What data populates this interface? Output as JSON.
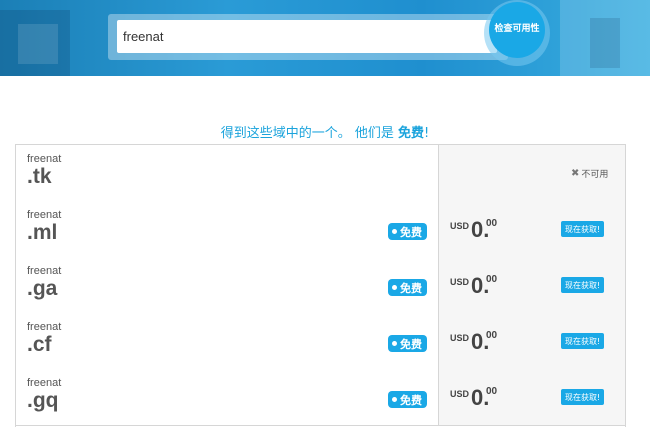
{
  "search": {
    "value": "freenat",
    "button_label": "检查可用性"
  },
  "headline": {
    "prefix": "得到这些域中的一个。 他们是 ",
    "bold": "免费",
    "suffix": "!"
  },
  "results": [
    {
      "name": "freenat",
      "tld": ".tk",
      "available": false,
      "status_label": "不可用"
    },
    {
      "name": "freenat",
      "tld": ".ml",
      "available": true,
      "badge": "免费",
      "currency": "USD",
      "price_int": "0.",
      "price_dec": "00",
      "button": "现在获取!"
    },
    {
      "name": "freenat",
      "tld": ".ga",
      "available": true,
      "badge": "免费",
      "currency": "USD",
      "price_int": "0.",
      "price_dec": "00",
      "button": "现在获取!"
    },
    {
      "name": "freenat",
      "tld": ".cf",
      "available": true,
      "badge": "免费",
      "currency": "USD",
      "price_int": "0.",
      "price_dec": "00",
      "button": "现在获取!"
    },
    {
      "name": "freenat",
      "tld": ".gq",
      "available": true,
      "badge": "免费",
      "currency": "USD",
      "price_int": "0.",
      "price_dec": "00",
      "button": "现在获取!"
    }
  ],
  "colors": {
    "accent": "#1aa8e6",
    "headline": "#1aa3dc",
    "text": "#555555"
  }
}
